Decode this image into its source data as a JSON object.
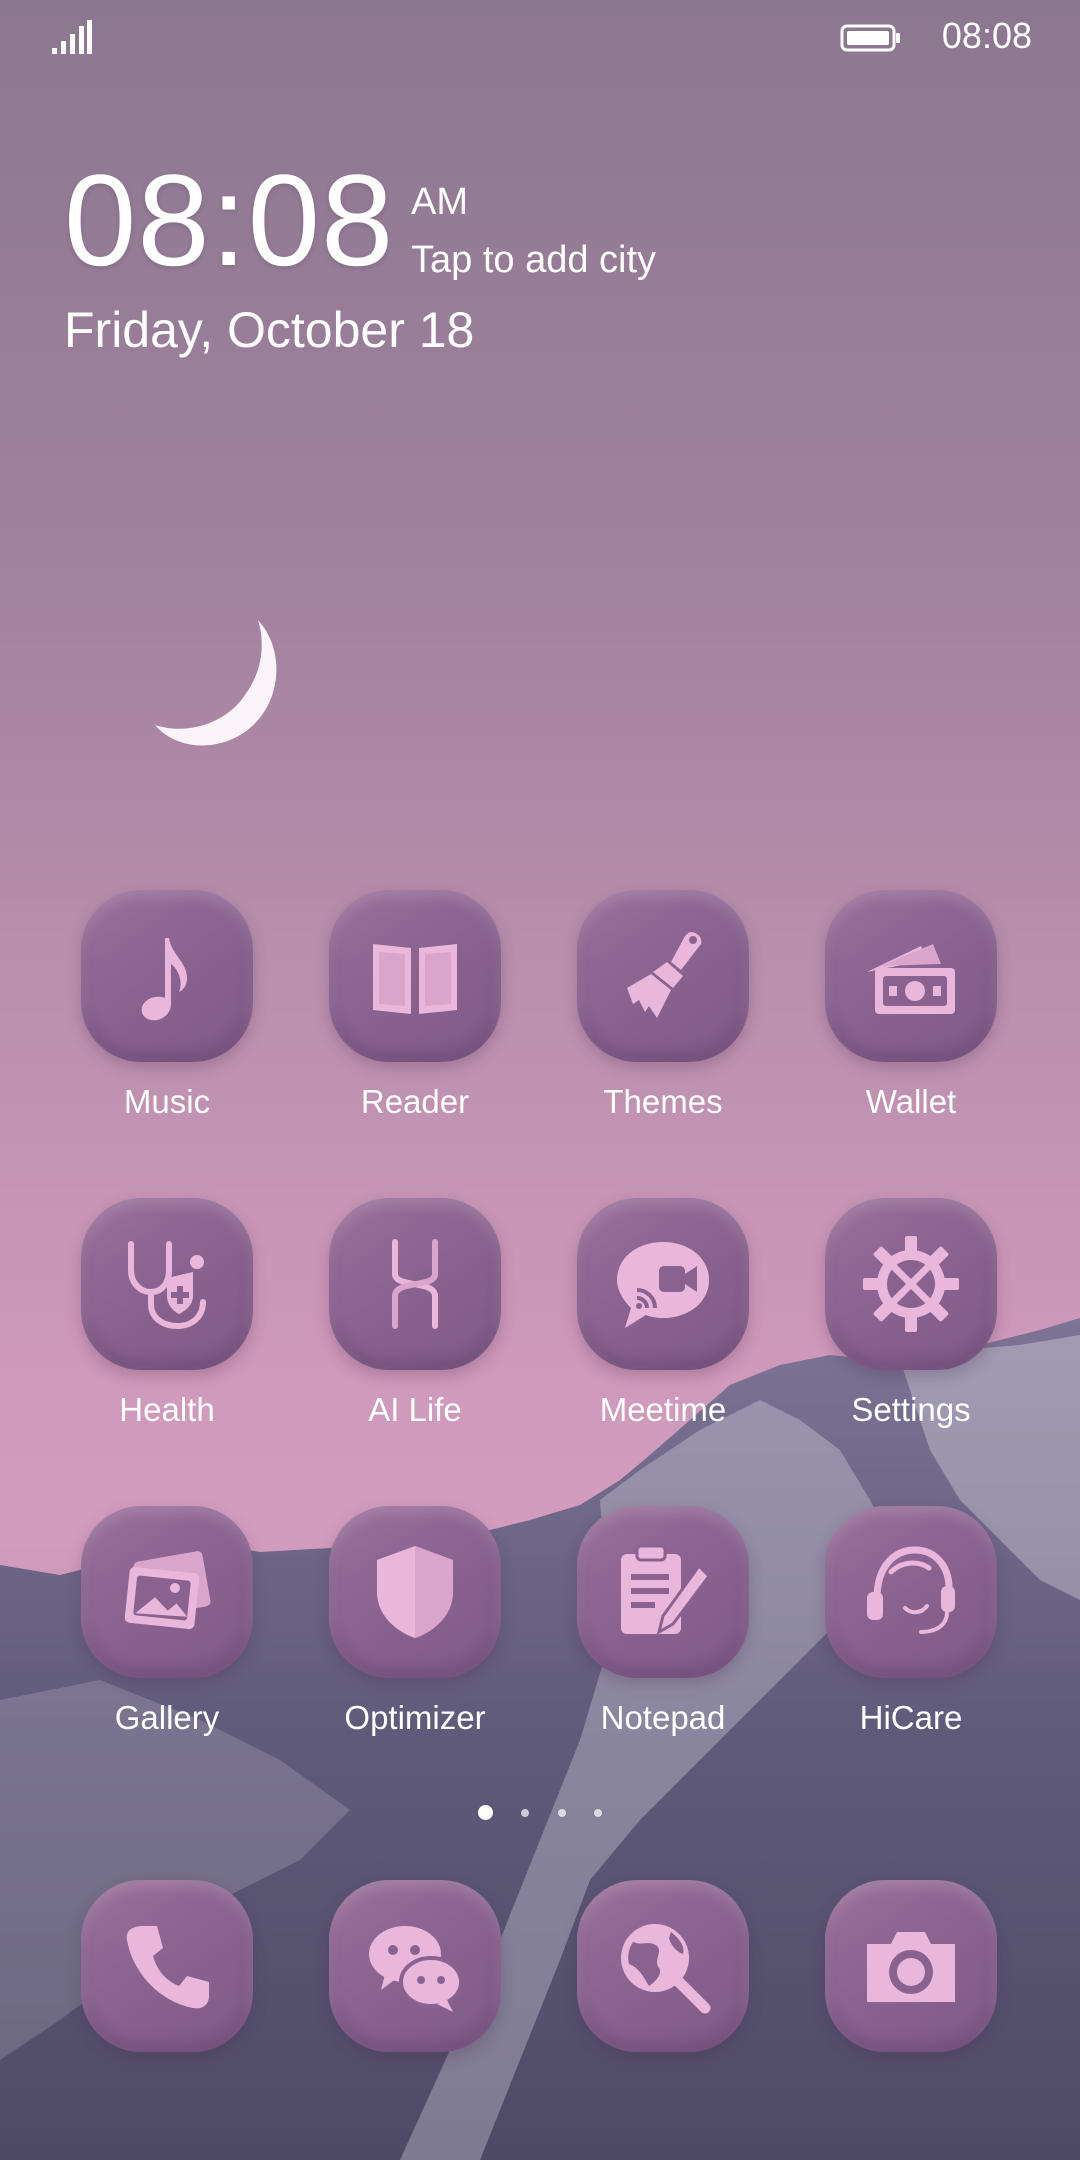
{
  "status_bar": {
    "time": "08:08",
    "signal_icon": "signal-icon",
    "battery_icon": "battery-icon"
  },
  "clock_widget": {
    "time": "08:08",
    "ampm": "AM",
    "city_hint": "Tap to add city",
    "date": "Friday, October 18"
  },
  "apps": [
    {
      "label": "Music",
      "icon": "music-note-icon"
    },
    {
      "label": "Reader",
      "icon": "book-icon"
    },
    {
      "label": "Themes",
      "icon": "paintbrush-icon"
    },
    {
      "label": "Wallet",
      "icon": "wallet-icon"
    },
    {
      "label": "Health",
      "icon": "stethoscope-icon"
    },
    {
      "label": "AI Life",
      "icon": "ai-life-icon"
    },
    {
      "label": "Meetime",
      "icon": "video-chat-icon"
    },
    {
      "label": "Settings",
      "icon": "gear-icon"
    },
    {
      "label": "Gallery",
      "icon": "gallery-icon"
    },
    {
      "label": "Optimizer",
      "icon": "shield-icon"
    },
    {
      "label": "Notepad",
      "icon": "notepad-icon"
    },
    {
      "label": "HiCare",
      "icon": "headset-icon"
    }
  ],
  "page_indicator": {
    "pages": 4,
    "active_page": 1
  },
  "dock": [
    {
      "icon": "phone-icon"
    },
    {
      "icon": "chat-icon"
    },
    {
      "icon": "browser-icon"
    },
    {
      "icon": "camera-icon"
    }
  ],
  "colors": {
    "icon_bg": "#8a6290",
    "glyph": "#e9b7dc",
    "text": "#ffffff"
  }
}
